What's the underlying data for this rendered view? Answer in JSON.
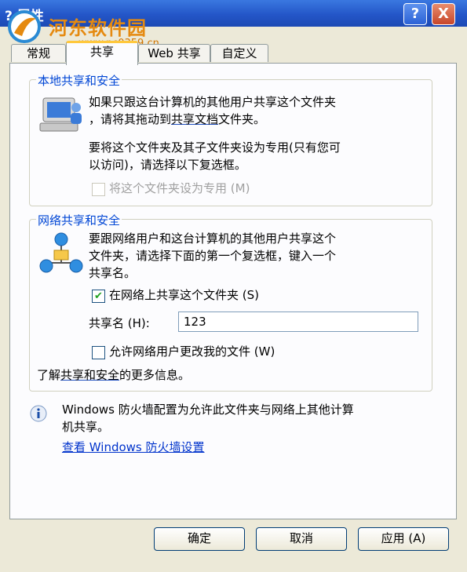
{
  "window": {
    "title": "? 属性"
  },
  "watermark": {
    "name": "河东软件园",
    "url": "www.pc0359.cn"
  },
  "title_buttons": {
    "help": "?",
    "close": "X"
  },
  "tabs": [
    {
      "label": "常规"
    },
    {
      "label": "共享"
    },
    {
      "label": "Web 共享"
    },
    {
      "label": "自定义"
    }
  ],
  "local_group": {
    "label": "本地共享和安全",
    "text1a": "如果只跟这台计算机的其他用户共享这个文件夹",
    "text1b_pre": "，请将其拖动到",
    "text1b_link": "共享文档",
    "text1b_post": "文件夹。",
    "text2a": "要将这个文件夹及其子文件夹设为专用(只有您可",
    "text2b": "以访问)，请选择以下复选框。",
    "private_checkbox": "将这个文件夹设为专用 (M)"
  },
  "network_group": {
    "label": "网络共享和安全",
    "text1": "要跟网络用户和这台计算机的其他用户共享这个",
    "text2": "文件夹，请选择下面的第一个复选框，键入一个",
    "text3": "共享名。",
    "share_checkbox": "在网络上共享这个文件夹 (S)",
    "share_checked": true,
    "share_name_label": "共享名 (H):",
    "share_name_value": "123",
    "allow_checkbox": "允许网络用户更改我的文件 (W)",
    "allow_checked": false,
    "more_pre": "了解",
    "more_link": "共享和安全",
    "more_post": "的更多信息。"
  },
  "firewall": {
    "text1": "Windows 防火墙配置为允许此文件夹与网络上其他计算",
    "text2": "机共享。",
    "link": "查看 Windows 防火墙设置"
  },
  "buttons": {
    "ok": "确定",
    "cancel": "取消",
    "apply": "应用 (A)"
  },
  "colors": {
    "title_bar": "#2456c8",
    "group_label": "#0046d5",
    "dialog_bg": "#ece9d8"
  }
}
